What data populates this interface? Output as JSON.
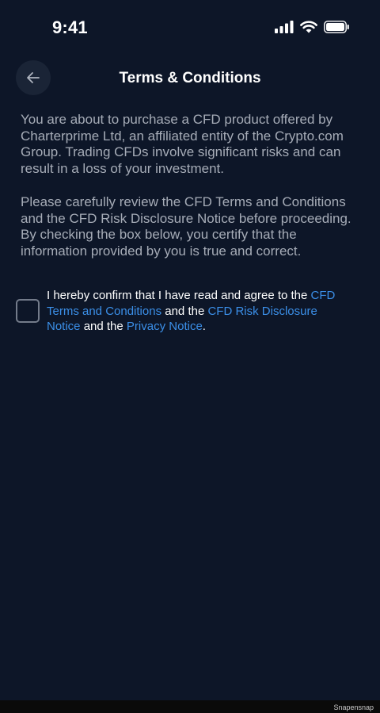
{
  "status_bar": {
    "time": "9:41",
    "icons": [
      "signal-icon",
      "wifi-icon",
      "battery-icon"
    ]
  },
  "nav": {
    "back_icon": "arrow-left-icon",
    "title": "Terms & Conditions"
  },
  "content": {
    "paragraphs": [
      "You are about to purchase a CFD product offered by Charterprime Ltd, an affiliated entity of the Crypto.com Group. Trading CFDs involve significant risks and can result in a loss of your investment.",
      "Please carefully review the CFD Terms and Conditions and the CFD Risk Disclosure Notice before proceeding. By checking the box below, you certify that the information provided by you is true and correct."
    ]
  },
  "consent": {
    "checked": false,
    "text_1": "I hereby confirm that I have read and agree to the ",
    "link_terms": "CFD Terms and Conditions",
    "text_2": " and the ",
    "link_risk": "CFD Risk Disclosure Notice",
    "text_3": " and the ",
    "link_privacy": "Privacy Notice",
    "text_4": "."
  },
  "watermark": "Snapensnap",
  "colors": {
    "background": "#0d1628",
    "link": "#3b8fe8",
    "body_text": "#a6acb7",
    "back_button_bg": "#1a2436"
  }
}
